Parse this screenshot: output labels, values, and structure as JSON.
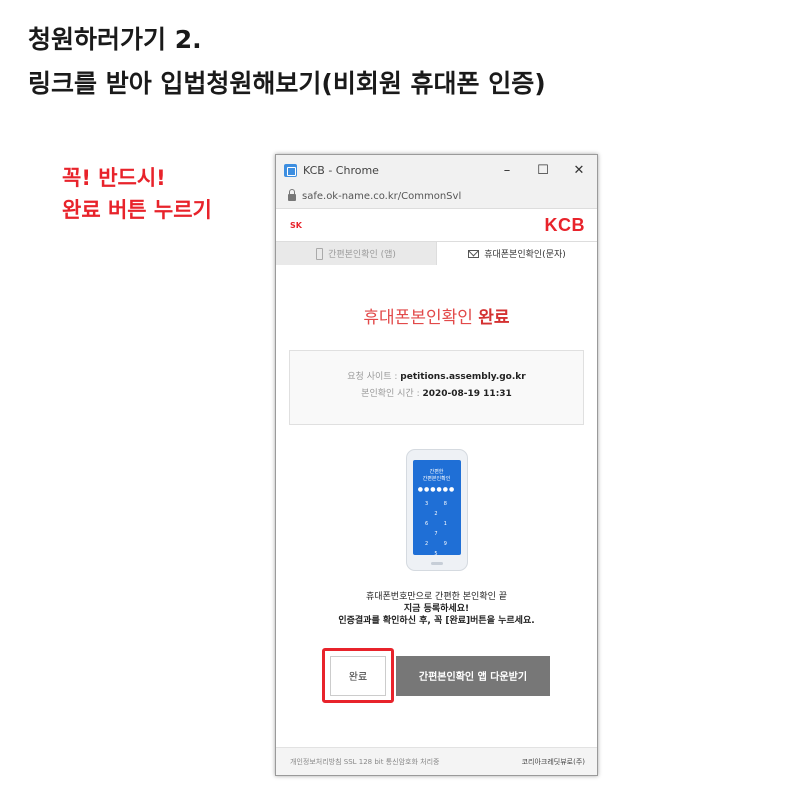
{
  "heading": {
    "line1": "청원하러가기 2.",
    "line2": "링크를 받아 입법청원해보기(비회원 휴대폰 인증)"
  },
  "callout": {
    "line1": "꼭! 반드시!",
    "line2": "완료 버튼 누르기"
  },
  "window": {
    "title": "KCB - Chrome",
    "minimize": "–",
    "maximize": "☐",
    "close": "✕",
    "url": "safe.ok-name.co.kr/CommonSvl"
  },
  "brand": {
    "sk_logo": "SK",
    "kcb_logo": "KCB"
  },
  "tabs": {
    "app_tab": "간편본인확인 (앱)",
    "sms_tab": "휴대폰본인확인(문자)"
  },
  "status": {
    "title_prefix": "휴대폰본인확인 ",
    "title_done": "완료"
  },
  "info": {
    "site_label": "요청 사이트 : ",
    "site_value": "petitions.assembly.go.kr",
    "time_label": "본인확인 시간 : ",
    "time_value": "2020-08-19 11:31"
  },
  "phone": {
    "screen_line1": "간편한",
    "screen_line2": "간편본인확인",
    "dots": "●●●●●●",
    "keys_row1": "3 8 2",
    "keys_row2": "6 1 7",
    "keys_row3": "2 9 5"
  },
  "guide": {
    "line1": "휴대폰번호만으로 간편한 본인확인 끝",
    "line2": "지금 등록하세요!",
    "line3": "인증결과를 확인하신 후, 꼭 [완료]버튼을 누르세요."
  },
  "buttons": {
    "done": "완료",
    "app_download": "간편본인확인 앱 다운받기"
  },
  "footer": {
    "links": "개인정보처리방침   SSL 128 bit 통신암호화 처리중",
    "copyright": "코리아크레딧뷰로(주)"
  },
  "colors": {
    "accent_red": "#e8232b",
    "phone_blue": "#1f6fd6",
    "button_gray": "#777777"
  }
}
